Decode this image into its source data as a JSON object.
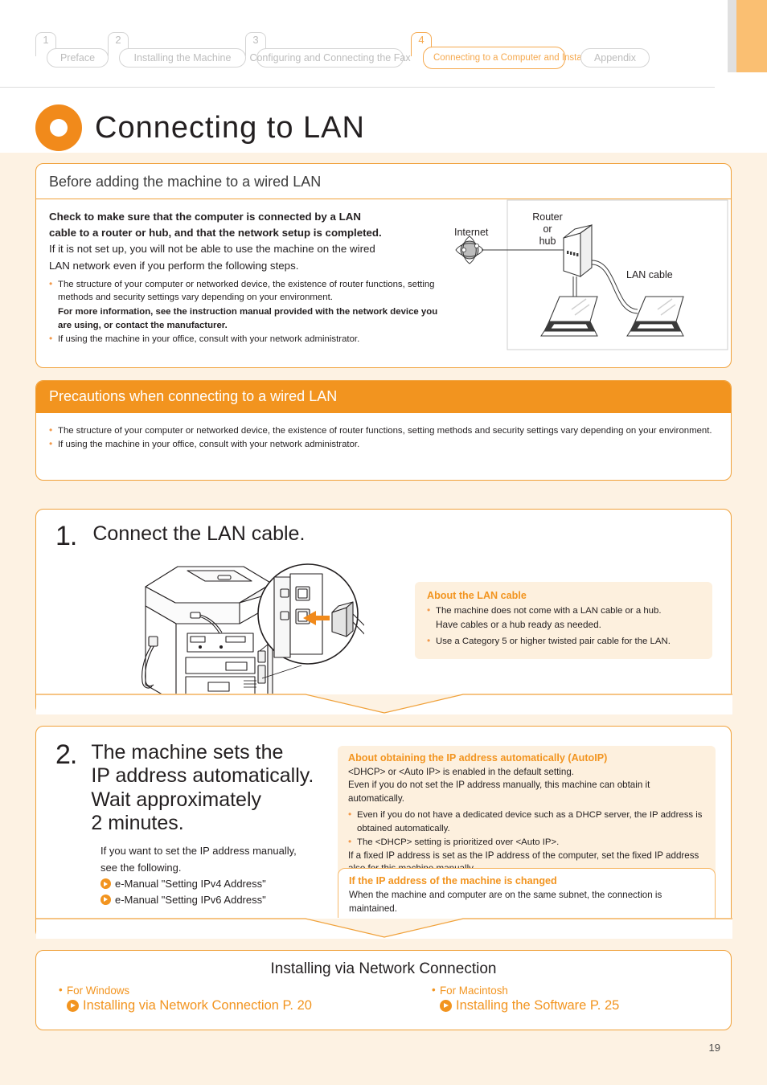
{
  "breadcrumb": {
    "items": [
      {
        "num": "1",
        "label": "Preface",
        "active": false
      },
      {
        "num": "2",
        "label": "Installing the Machine",
        "active": false
      },
      {
        "num": "3",
        "label": "Configuring and Connecting the Fax",
        "active": false
      },
      {
        "num": "4",
        "label": "Connecting to a Computer and Installing the Drivers",
        "active": true
      },
      {
        "num": "",
        "label": "Appendix",
        "active": false
      }
    ]
  },
  "page": {
    "title": "Connecting to LAN",
    "number": "19",
    "accent": "#f18a1b",
    "accent_head": "#f2941f",
    "panel_border": "#f0a13a",
    "callout_bg": "#fdf0de",
    "page_bg": "#fdf2e3"
  },
  "before_panel": {
    "heading": "Before adding the machine to a wired LAN",
    "lead_bold_1": "Check to make sure that the computer is connected by a LAN",
    "lead_bold_2": "cable to a router or hub, and that the network setup is completed.",
    "lead_norm_1": "If it is not set up, you will not be able to use the machine on the wired",
    "lead_norm_2": "LAN network even if you perform the following steps.",
    "bullets": [
      "The structure of your computer or networked device, the existence of router functions, setting methods and security settings vary depending on your environment.",
      "If using the machine in your office, consult with your network administrator."
    ],
    "bullet_1_bold": "For more information, see the instruction manual provided with the network device you are using, or contact the manufacturer."
  },
  "diagram": {
    "internet_label": "Internet",
    "router_label_1": "Router",
    "router_label_2": "or",
    "router_label_3": "hub",
    "lan_cable_label": "LAN cable"
  },
  "precautions_panel": {
    "heading": "Precautions when connecting to a wired LAN",
    "bullets": [
      "The structure of your computer or networked device, the existence of router functions, setting methods and security settings vary depending on your environment.",
      "If using the machine in your office, consult with your network administrator."
    ]
  },
  "step1": {
    "number": "1.",
    "title": "Connect the LAN cable.",
    "callout": {
      "title": "About the LAN cable",
      "bullet_1": "The machine does not come with a LAN cable or a hub.",
      "bullet_1_cont": "Have cables or a hub ready as needed.",
      "bullet_2": "Use a Category 5 or higher twisted pair cable for the LAN."
    }
  },
  "step2": {
    "number": "2.",
    "title_line_1": "The machine sets the",
    "title_line_2": "IP address automatically.",
    "title_line_3": "Wait approximately",
    "title_line_4": "2 minutes.",
    "sub_line_1": "If you want to set the IP address manually,",
    "sub_line_2": "see the following.",
    "link_1": "e-Manual \"Setting IPv4 Address\"",
    "link_2": "e-Manual \"Setting IPv6 Address\"",
    "autoip": {
      "title": "About obtaining the IP address automatically (AutoIP)",
      "line_1": "<DHCP> or <Auto IP> is enabled in the default setting.",
      "line_2": "Even if you do not set the IP address manually, this machine can obtain it automatically.",
      "bullet_1": "Even if you do not have a dedicated device such as a DHCP server, the IP address is obtained automatically.",
      "bullet_2": "The <DHCP> setting is prioritized over <Auto IP>.",
      "line_3": "If a fixed IP address is set as the IP address of the computer, set the fixed IP address also for this machine manually."
    },
    "ipchanged": {
      "title": "If the IP address of the machine is changed",
      "line_1": "When the machine and computer are on the same subnet, the connection is maintained."
    }
  },
  "install_panel": {
    "heading": "Installing via Network Connection",
    "windows_label": "For Windows",
    "windows_link": "Installing via Network Connection P. 20",
    "macintosh_label": "For Macintosh",
    "macintosh_link": "Installing the Software P. 25"
  }
}
